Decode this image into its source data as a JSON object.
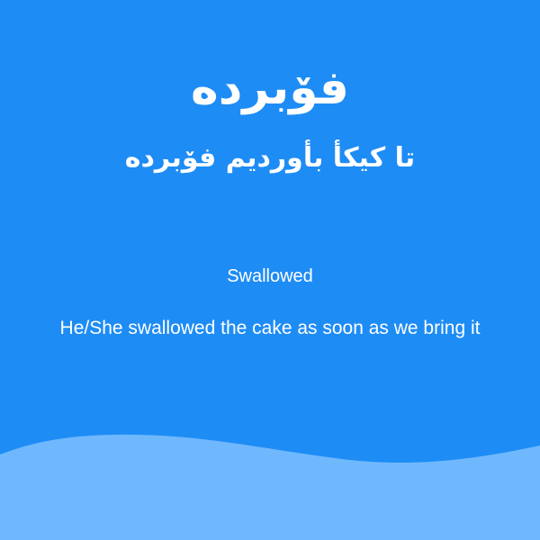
{
  "card": {
    "word": "فۆبرده",
    "example_sentence": "تا کیکأ بأوردیم فۆبرده",
    "translation": "Swallowed",
    "example_translation": "He/She swallowed the cake as soon as we bring it"
  },
  "colors": {
    "background": "#1e8cf5",
    "wave": "#6fb8fd",
    "text": "#ffffff"
  }
}
